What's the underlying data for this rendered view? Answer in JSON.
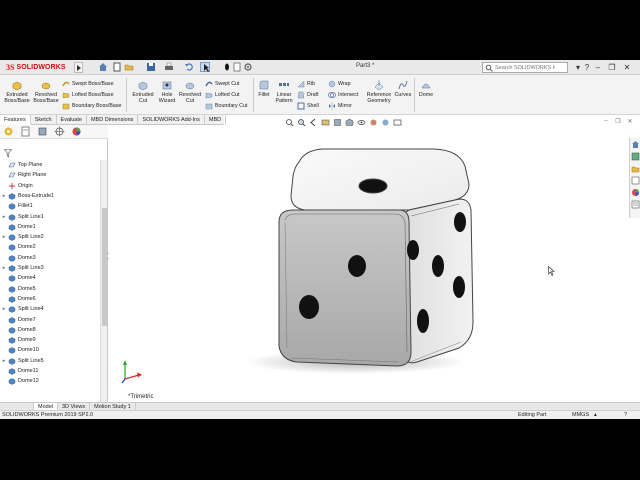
{
  "app": {
    "brand_prefix": "3S",
    "brand": "SOLIDWORKS",
    "document_title": "Part3 *",
    "search_placeholder": "Search SOLIDWORKS Help",
    "accent_color": "#cc1111"
  },
  "ribbon": {
    "extruded_boss": "Extruded Boss/Base",
    "revolved_boss": "Revolved Boss/Base",
    "swept_boss": "Swept Boss/Base",
    "lofted_boss": "Lofted Boss/Base",
    "boundary_boss": "Boundary Boss/Base",
    "extruded_cut": "Extruded Cut",
    "hole_wizard": "Hole Wizard",
    "revolved_cut": "Revolved Cut",
    "swept_cut": "Swept Cut",
    "lofted_cut": "Lofted Cut",
    "boundary_cut": "Boundary Cut",
    "fillet": "Fillet",
    "linear_pattern": "Linear Pattern",
    "rib": "Rib",
    "draft": "Draft",
    "shell": "Shell",
    "wrap": "Wrap",
    "intersect": "Intersect",
    "mirror": "Mirror",
    "reference_geometry": "Reference Geometry",
    "curves": "Curves",
    "dome": "Dome"
  },
  "tabs": [
    "Features",
    "Sketch",
    "Evaluate",
    "MBD Dimensions",
    "SOLIDWORKS Add-Ins",
    "MBD"
  ],
  "tree": [
    {
      "label": "Top Plane",
      "icon": "plane-icon",
      "expandable": false
    },
    {
      "label": "Right Plane",
      "icon": "plane-icon",
      "expandable": false
    },
    {
      "label": "Origin",
      "icon": "origin-icon",
      "expandable": false
    },
    {
      "label": "Boss-Extrude1",
      "icon": "feature-icon",
      "expandable": true
    },
    {
      "label": "Fillet1",
      "icon": "feature-icon",
      "expandable": false
    },
    {
      "label": "Split Line1",
      "icon": "feature-icon",
      "expandable": true
    },
    {
      "label": "Dome1",
      "icon": "feature-icon",
      "expandable": false
    },
    {
      "label": "Split Line2",
      "icon": "feature-icon",
      "expandable": true
    },
    {
      "label": "Dome2",
      "icon": "feature-icon",
      "expandable": false
    },
    {
      "label": "Dome3",
      "icon": "feature-icon",
      "expandable": false
    },
    {
      "label": "Split Line3",
      "icon": "feature-icon",
      "expandable": true
    },
    {
      "label": "Dome4",
      "icon": "feature-icon",
      "expandable": false
    },
    {
      "label": "Dome5",
      "icon": "feature-icon",
      "expandable": false
    },
    {
      "label": "Dome6",
      "icon": "feature-icon",
      "expandable": false
    },
    {
      "label": "Split Line4",
      "icon": "feature-icon",
      "expandable": true
    },
    {
      "label": "Dome7",
      "icon": "feature-icon",
      "expandable": false
    },
    {
      "label": "Dome8",
      "icon": "feature-icon",
      "expandable": false
    },
    {
      "label": "Dome9",
      "icon": "feature-icon",
      "expandable": false
    },
    {
      "label": "Dome10",
      "icon": "feature-icon",
      "expandable": false
    },
    {
      "label": "Split Line5",
      "icon": "feature-icon",
      "expandable": true
    },
    {
      "label": "Dome11",
      "icon": "feature-icon",
      "expandable": false
    },
    {
      "label": "Dome12",
      "icon": "feature-icon",
      "expandable": false
    }
  ],
  "viewport": {
    "view_label": "*Trimetric"
  },
  "bottom_tabs": [
    "Model",
    "3D Views",
    "Motion Study 1"
  ],
  "status": {
    "product": "SOLIDWORKS Premium 2019 SP2.0",
    "mode": "Editing Part",
    "units": "MMGS"
  }
}
